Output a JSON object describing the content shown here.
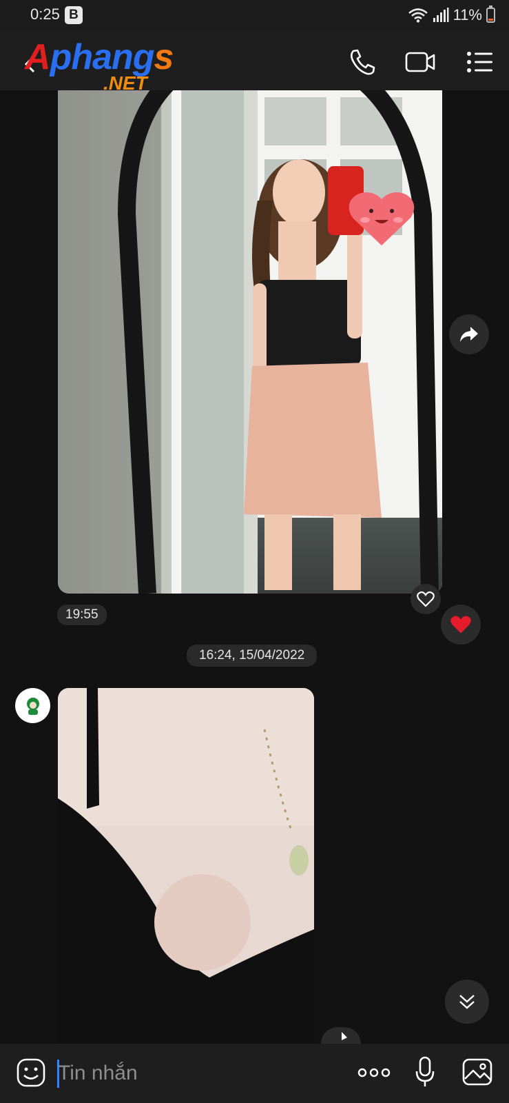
{
  "status_bar": {
    "time": "0:25",
    "badge": "B",
    "battery_level": "11%"
  },
  "header": {
    "logo_main": [
      "A",
      "phang",
      "s"
    ],
    "logo_sub": ".NET",
    "icons": [
      "back-icon",
      "phone-icon",
      "video-call-icon",
      "menu-list-icon"
    ]
  },
  "messages": {
    "photo1_time": "19:55",
    "date_separator": "16:24, 15/04/2022"
  },
  "input": {
    "placeholder": "Tin nhắn",
    "icons": [
      "emoji-icon",
      "more-icon",
      "microphone-icon",
      "image-icon"
    ]
  },
  "colors": {
    "background": "#121212",
    "bar": "#1e1e1e",
    "reaction_heart": "#e51b2b",
    "caret": "#2f86ff"
  }
}
